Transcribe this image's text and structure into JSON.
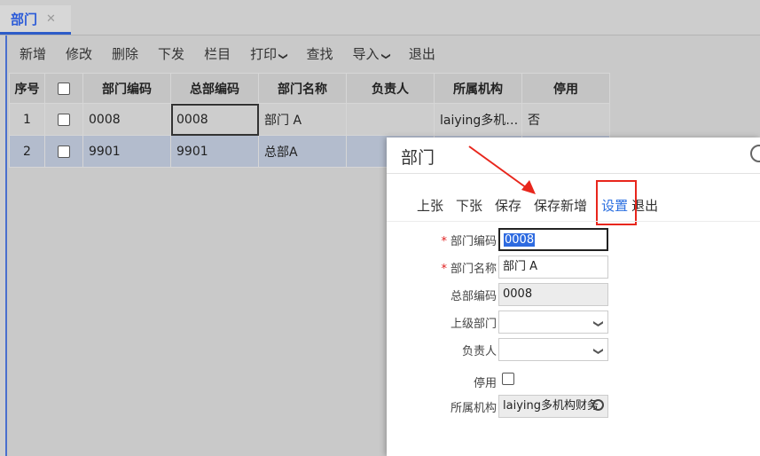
{
  "tabs": [
    {
      "label": "部门",
      "close": "✕"
    }
  ],
  "toolbar": {
    "items": [
      "新增",
      "修改",
      "删除",
      "下发",
      "栏目",
      "打印",
      "查找",
      "导入",
      "退出"
    ],
    "caret": "❯"
  },
  "grid": {
    "headers": [
      "序号",
      "",
      "部门编码",
      "总部编码",
      "部门名称",
      "负责人",
      "所属机构",
      "停用"
    ],
    "rows": [
      {
        "no": "1",
        "code": "0008",
        "hq_code": "0008",
        "name": "部门 A",
        "owner": "",
        "org": "laiying多机…",
        "disabled": "否"
      },
      {
        "no": "2",
        "code": "9901",
        "hq_code": "9901",
        "name": "总部A",
        "owner": "",
        "org": "",
        "disabled": ""
      }
    ]
  },
  "dialog": {
    "title": "部门",
    "toolbar": [
      "上张",
      "下张",
      "保存",
      "保存新增",
      "设置",
      "退出"
    ],
    "fields": {
      "dept_code_label": "部门编码",
      "dept_code_value": "0008",
      "dept_name_label": "部门名称",
      "dept_name_value": "部门 A",
      "hq_code_label": "总部编码",
      "hq_code_value": "0008",
      "parent_label": "上级部门",
      "parent_value": "",
      "owner_label": "负责人",
      "owner_value": "",
      "disabled_label": "停用",
      "org_label": "所属机构",
      "org_value": "laiying多机构财务"
    },
    "required_mark": "*"
  },
  "colors": {
    "accent": "#2b5bd8",
    "highlight": "#e8261c",
    "link": "#2b6fe0"
  }
}
